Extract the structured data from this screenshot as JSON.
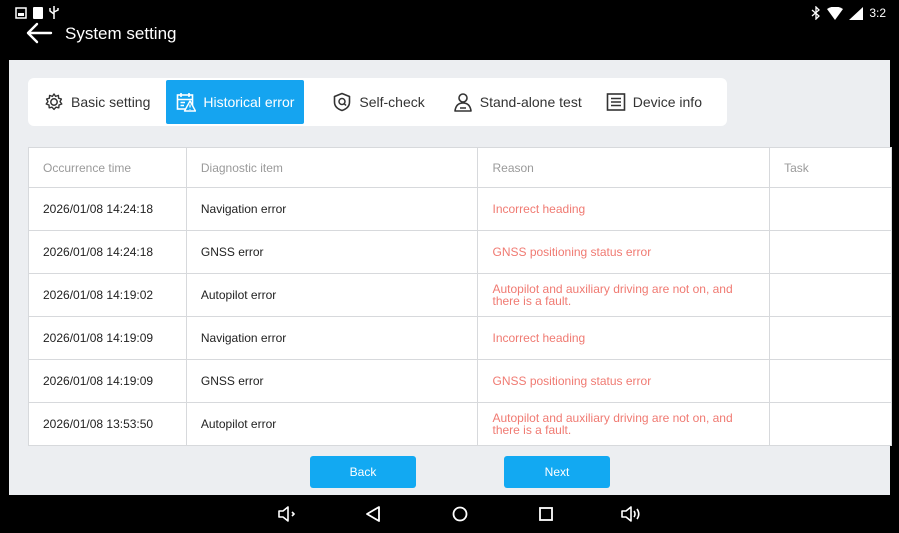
{
  "header": {
    "title": "System setting",
    "clock": "3:2"
  },
  "tabs": [
    {
      "label": "Basic setting",
      "icon": "gear-icon"
    },
    {
      "label": "Historical error",
      "icon": "calendar-warning-icon"
    },
    {
      "label": "Self-check",
      "icon": "shield-check-icon"
    },
    {
      "label": "Stand-alone test",
      "icon": "user-test-icon"
    },
    {
      "label": "Device info",
      "icon": "device-info-icon"
    }
  ],
  "active_tab": "Historical error",
  "table": {
    "columns": [
      "Occurrence time",
      "Diagnostic item",
      "Reason",
      "Task"
    ],
    "rows": [
      {
        "time": "2026/01/08 14:24:18",
        "item": "Navigation error",
        "reason": "Incorrect heading",
        "task": ""
      },
      {
        "time": "2026/01/08 14:24:18",
        "item": "GNSS error",
        "reason": "GNSS positioning status error",
        "task": ""
      },
      {
        "time": "2026/01/08 14:19:02",
        "item": "Autopilot error",
        "reason": "Autopilot and auxiliary driving are not on, and there is a fault.",
        "task": ""
      },
      {
        "time": "2026/01/08 14:19:09",
        "item": "Navigation error",
        "reason": "Incorrect heading",
        "task": ""
      },
      {
        "time": "2026/01/08 14:19:09",
        "item": "GNSS error",
        "reason": "GNSS positioning status error",
        "task": ""
      },
      {
        "time": "2026/01/08 13:53:50",
        "item": "Autopilot error",
        "reason": "Autopilot and auxiliary driving are not on, and there is a fault.",
        "task": ""
      }
    ]
  },
  "buttons": {
    "back": "Back",
    "next": "Next"
  },
  "colors": {
    "accent": "#15a4f0",
    "error_text": "#f07a72",
    "background": "#eceef1"
  }
}
